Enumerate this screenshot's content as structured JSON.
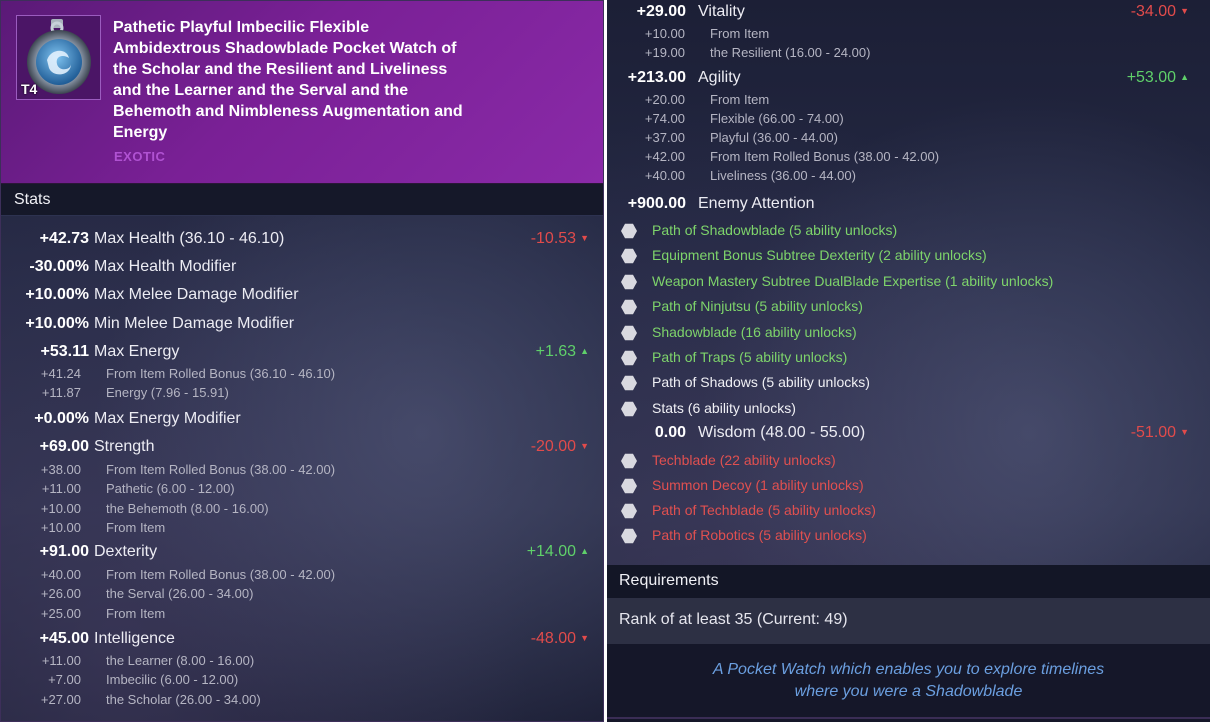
{
  "item": {
    "tier": "T4",
    "name": "Pathetic Playful Imbecilic Flexible Ambidextrous Shadowblade Pocket Watch of the Scholar and the Resilient and Liveliness and the Learner and the Serval and the Behemoth and Nimbleness  Augmentation and Energy",
    "rarity": "EXOTIC",
    "rarity_color": "#b052d2"
  },
  "stats_header": "Stats",
  "colors": {
    "negative": "#e14b4b",
    "positive": "#5fd06a",
    "unlock_green": "#7ed46b",
    "unlock_red": "#e05050"
  },
  "left_stats": [
    {
      "value": "+42.73",
      "label": "Max Health",
      "range": "(36.10 - 46.10)",
      "diff": "-10.53",
      "diff_dir": "down",
      "subs": []
    },
    {
      "value": "-30.00%",
      "label": "Max Health Modifier",
      "range": "",
      "diff": "",
      "diff_dir": "",
      "subs": []
    },
    {
      "value": "+10.00%",
      "label": "Max Melee Damage Modifier",
      "range": "",
      "diff": "",
      "diff_dir": "",
      "subs": []
    },
    {
      "value": "+10.00%",
      "label": "Min Melee Damage Modifier",
      "range": "",
      "diff": "",
      "diff_dir": "",
      "subs": []
    },
    {
      "value": "+53.11",
      "label": "Max Energy",
      "range": "",
      "diff": "+1.63",
      "diff_dir": "up",
      "subs": [
        {
          "value": "+41.24",
          "label": "From Item Rolled Bonus  (36.10 - 46.10)"
        },
        {
          "value": "+11.87",
          "label": "Energy  (7.96 - 15.91)"
        }
      ]
    },
    {
      "value": "+0.00%",
      "label": "Max Energy Modifier",
      "range": "",
      "diff": "",
      "diff_dir": "",
      "subs": []
    },
    {
      "value": "+69.00",
      "label": "Strength",
      "range": "",
      "diff": "-20.00",
      "diff_dir": "down",
      "subs": [
        {
          "value": "+38.00",
          "label": "From Item Rolled Bonus  (38.00 - 42.00)"
        },
        {
          "value": "+11.00",
          "label": "Pathetic  (6.00 - 12.00)"
        },
        {
          "value": "+10.00",
          "label": "the Behemoth  (8.00 - 16.00)"
        },
        {
          "value": "+10.00",
          "label": "From Item"
        }
      ]
    },
    {
      "value": "+91.00",
      "label": "Dexterity",
      "range": "",
      "diff": "+14.00",
      "diff_dir": "up",
      "subs": [
        {
          "value": "+40.00",
          "label": "From Item Rolled Bonus  (38.00 - 42.00)"
        },
        {
          "value": "+26.00",
          "label": "the Serval  (26.00 - 34.00)"
        },
        {
          "value": "+25.00",
          "label": "From Item"
        }
      ]
    },
    {
      "value": "+45.00",
      "label": "Intelligence",
      "range": "",
      "diff": "-48.00",
      "diff_dir": "down",
      "subs": [
        {
          "value": "+11.00",
          "label": "the Learner  (8.00 - 16.00)"
        },
        {
          "value": "+7.00",
          "label": "Imbecilic  (6.00 - 12.00)"
        },
        {
          "value": "+27.00",
          "label": "the Scholar  (26.00 - 34.00)"
        }
      ]
    }
  ],
  "right_stats": {
    "vitality": {
      "value": "+29.00",
      "label": "Vitality",
      "diff": "-34.00",
      "diff_dir": "down",
      "subs": [
        {
          "value": "+10.00",
          "label": "From Item"
        },
        {
          "value": "+19.00",
          "label": "the Resilient  (16.00 - 24.00)"
        }
      ]
    },
    "agility": {
      "value": "+213.00",
      "label": "Agility",
      "diff": "+53.00",
      "diff_dir": "up",
      "subs": [
        {
          "value": "+20.00",
          "label": "From Item"
        },
        {
          "value": "+74.00",
          "label": "Flexible  (66.00 - 74.00)"
        },
        {
          "value": "+37.00",
          "label": "Playful  (36.00 - 44.00)"
        },
        {
          "value": "+42.00",
          "label": "From Item Rolled Bonus  (38.00 - 42.00)"
        },
        {
          "value": "+40.00",
          "label": "Liveliness  (36.00 - 44.00)"
        }
      ]
    },
    "enemy_attention": {
      "value": "+900.00",
      "label": "Enemy Attention"
    },
    "wisdom": {
      "value": "0.00",
      "label": "Wisdom  (48.00 - 55.00)",
      "diff": "-51.00",
      "diff_dir": "down"
    }
  },
  "unlocks_group1": [
    {
      "label": "Path of Shadowblade (5 ability unlocks)",
      "color": "green"
    },
    {
      "label": "Equipment Bonus Subtree Dexterity (2 ability unlocks)",
      "color": "green"
    },
    {
      "label": "Weapon Mastery Subtree DualBlade Expertise (1 ability unlocks)",
      "color": "green"
    },
    {
      "label": "Path of Ninjutsu (5 ability unlocks)",
      "color": "green"
    },
    {
      "label": "Shadowblade (16 ability unlocks)",
      "color": "green"
    },
    {
      "label": "Path of Traps (5 ability unlocks)",
      "color": "green"
    },
    {
      "label": "Path of Shadows (5 ability unlocks)",
      "color": "white"
    },
    {
      "label": "Stats (6 ability unlocks)",
      "color": "white"
    }
  ],
  "unlocks_group2": [
    {
      "label": "Techblade (22 ability unlocks)",
      "color": "red"
    },
    {
      "label": "Summon Decoy (1 ability unlocks)",
      "color": "red"
    },
    {
      "label": "Path of Techblade (5 ability unlocks)",
      "color": "red"
    },
    {
      "label": "Path of Robotics (5 ability unlocks)",
      "color": "red"
    }
  ],
  "requirements": {
    "header": "Requirements",
    "text": "Rank of at least 35 (Current: 49)"
  },
  "flavor": {
    "line1": "A Pocket Watch which enables you to explore timelines",
    "line2": "where you were a Shadowblade"
  }
}
